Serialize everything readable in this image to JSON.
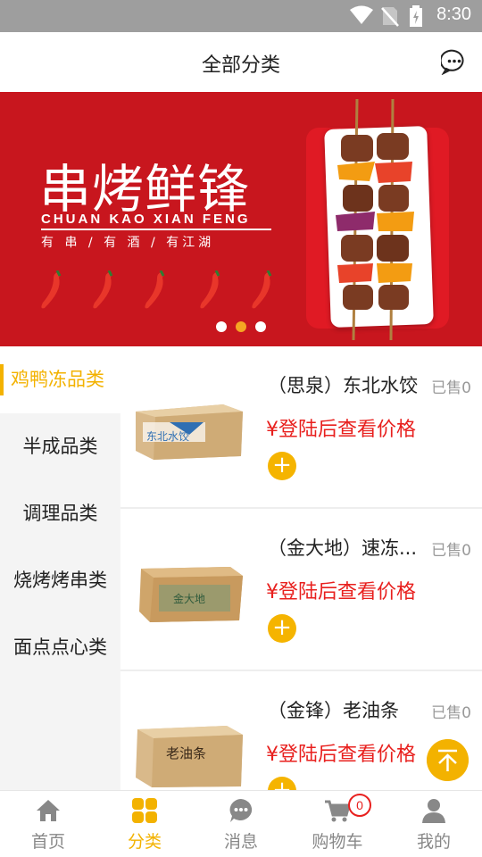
{
  "status_bar": {
    "time": "8:30",
    "icons": [
      "wifi-icon",
      "no-sim-icon",
      "battery-charging-icon"
    ]
  },
  "header": {
    "title": "全部分类",
    "message_icon": "chat-bubble-icon"
  },
  "banner": {
    "brand": "串烤鲜锋",
    "pinyin": "CHUAN KAO XIAN FENG",
    "slogan": "有 串 / 有 酒 / 有江湖",
    "dots_total": 3,
    "active_dot": 2,
    "colors": {
      "background": "#c8161e",
      "active_dot": "#f5a623"
    }
  },
  "sidebar": {
    "items": [
      {
        "label": "鸡鸭冻品类",
        "active": true
      },
      {
        "label": "半成品类",
        "active": false
      },
      {
        "label": "调理品类",
        "active": false
      },
      {
        "label": "烧烤烤串类",
        "active": false
      },
      {
        "label": "面点点心类",
        "active": false
      }
    ]
  },
  "products": [
    {
      "name": "（思泉）东北水饺",
      "sold": "已售0",
      "price": "¥登陆后查看价格",
      "add": "+",
      "box_text": "东北水饺"
    },
    {
      "name": "（金大地）速冻...",
      "sold": "已售0",
      "price": "¥登陆后查看价格",
      "add": "+",
      "box_text": "金大地"
    },
    {
      "name": "（金锋）老油条",
      "sold": "已售0",
      "price": "¥登陆后查看价格",
      "add": "+",
      "box_text": "老油条"
    }
  ],
  "tabbar": {
    "items": [
      {
        "label": "首页",
        "icon": "home-icon",
        "active": false
      },
      {
        "label": "分类",
        "icon": "grid-icon",
        "active": true
      },
      {
        "label": "消息",
        "icon": "message-icon",
        "active": false
      },
      {
        "label": "购物车",
        "icon": "cart-icon",
        "active": false
      },
      {
        "label": "我的",
        "icon": "user-icon",
        "active": false
      }
    ],
    "cart_badge": "0"
  },
  "colors": {
    "accent": "#f3b200",
    "price": "#e8201e"
  }
}
